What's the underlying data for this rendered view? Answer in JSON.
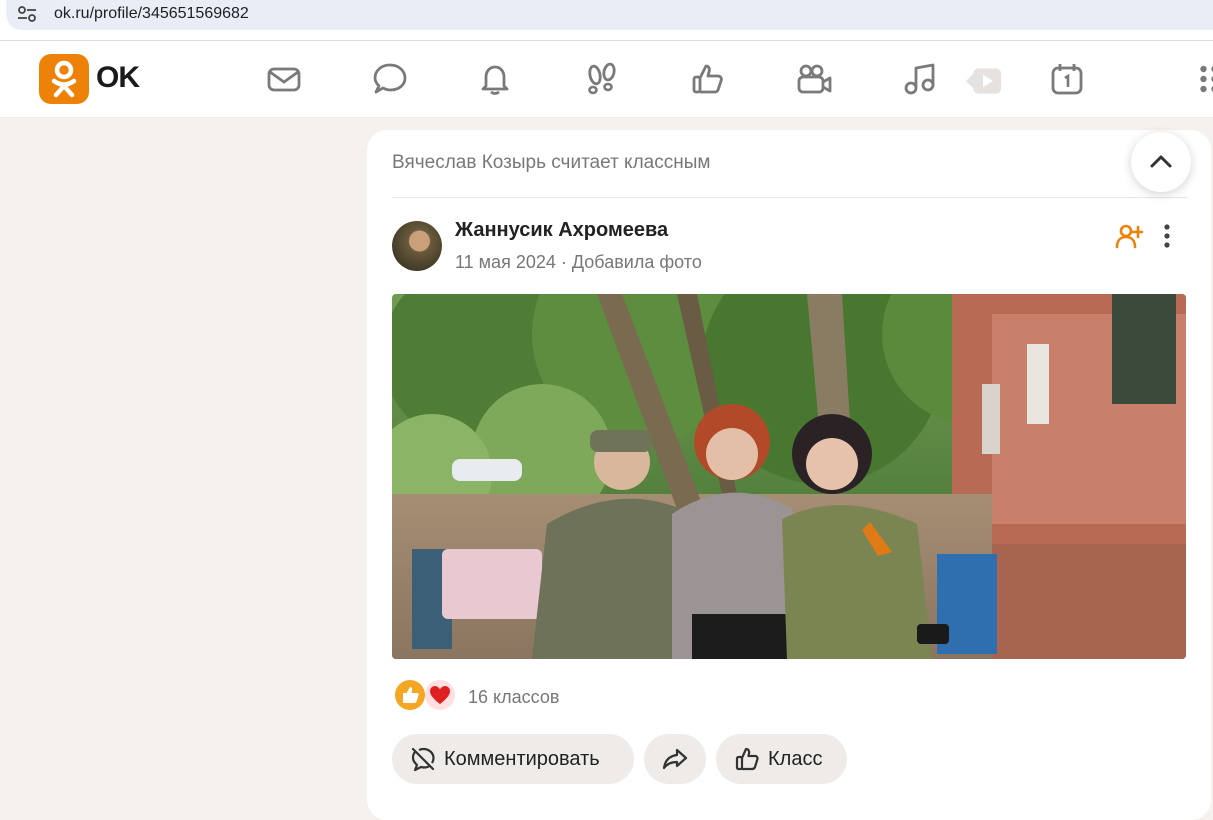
{
  "browser": {
    "url": "ok.ru/profile/345651569682"
  },
  "header": {
    "logo_text": "OK",
    "nav_icons": [
      "mail-icon",
      "chat-icon",
      "bell-icon",
      "footprints-icon",
      "thumbs-up-icon",
      "video-camera-icon",
      "music-icon",
      "video-play-icon",
      "calendar-icon",
      "apps-grid-icon"
    ]
  },
  "post": {
    "activity": "Вячеслав Козырь считает классным",
    "author": "Жаннусик Ахромеева",
    "date": "11 мая 2024",
    "separator": "·",
    "action": "Добавила фото",
    "reactions_count": "16 классов",
    "buttons": {
      "comment": "Комментировать",
      "klass": "Класс"
    }
  },
  "colors": {
    "brand": "#ee8208",
    "card": "#ffffff",
    "page_bg": "#f5f1ee",
    "button_bg": "#efebe8"
  }
}
